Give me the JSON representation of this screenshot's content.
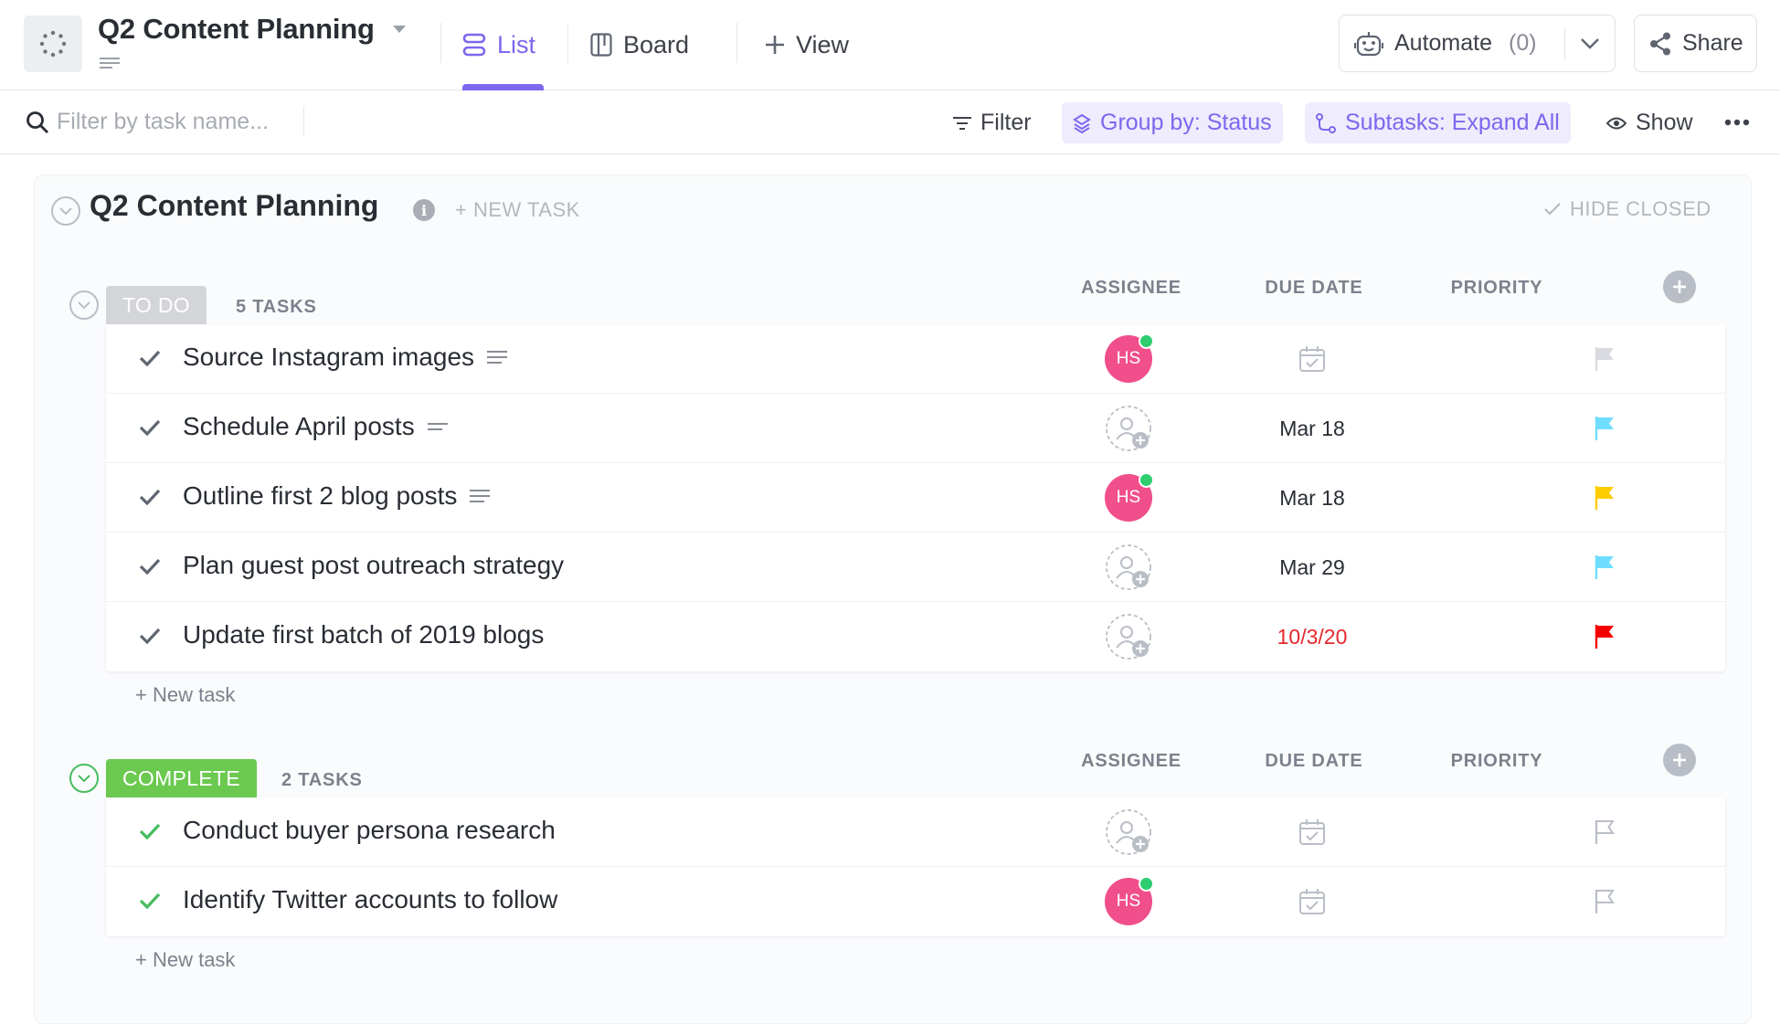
{
  "header": {
    "project_title": "Q2 Content Planning",
    "tabs": [
      {
        "label": "List",
        "icon": "list-icon",
        "active": true
      },
      {
        "label": "Board",
        "icon": "board-icon",
        "active": false
      },
      {
        "label": "View",
        "icon": "plus-icon",
        "active": false
      }
    ],
    "automate_label": "Automate",
    "automate_count": "(0)",
    "share_label": "Share"
  },
  "toolbar": {
    "search_placeholder": "Filter by task name...",
    "filter_label": "Filter",
    "group_by_label": "Group by: Status",
    "subtasks_label": "Subtasks: Expand All",
    "show_label": "Show"
  },
  "list": {
    "title": "Q2 Content Planning",
    "new_task_label": "+ NEW TASK",
    "hide_closed_label": "HIDE CLOSED",
    "columns": {
      "assignee": "ASSIGNEE",
      "due_date": "DUE DATE",
      "priority": "PRIORITY"
    },
    "add_task_label": "+ New task"
  },
  "groups": [
    {
      "status": "TO DO",
      "status_color": "#d3d5d9",
      "count_label": "5 TASKS",
      "tasks": [
        {
          "name": "Source Instagram images",
          "has_description": true,
          "assignee": "HS",
          "due": "",
          "priority": "none"
        },
        {
          "name": "Schedule April posts",
          "has_description": true,
          "assignee": "",
          "due": "Mar 18",
          "priority": "normal"
        },
        {
          "name": "Outline first 2 blog posts",
          "has_description": true,
          "assignee": "HS",
          "due": "Mar 18",
          "priority": "high"
        },
        {
          "name": "Plan guest post outreach strategy",
          "has_description": false,
          "assignee": "",
          "due": "Mar 29",
          "priority": "normal"
        },
        {
          "name": "Update first batch of 2019 blogs",
          "has_description": false,
          "assignee": "",
          "due": "10/3/20",
          "overdue": true,
          "priority": "urgent"
        }
      ]
    },
    {
      "status": "COMPLETE",
      "status_color": "#6bc950",
      "count_label": "2 TASKS",
      "tasks": [
        {
          "name": "Conduct buyer persona research",
          "has_description": false,
          "assignee": "",
          "due": "",
          "priority": "empty"
        },
        {
          "name": "Identify Twitter accounts to follow",
          "has_description": false,
          "assignee": "HS",
          "due": "",
          "priority": "empty"
        }
      ]
    }
  ],
  "colors": {
    "accent": "#7b68ee",
    "avatar": "#f14f8b",
    "flag_normal": "#6fddff",
    "flag_high": "#ffcc00",
    "flag_urgent": "#f50000",
    "flag_none": "#d8dadf",
    "check_todo": "#5f6672",
    "check_complete": "#47bc5e",
    "overdue": "#e5282c"
  }
}
